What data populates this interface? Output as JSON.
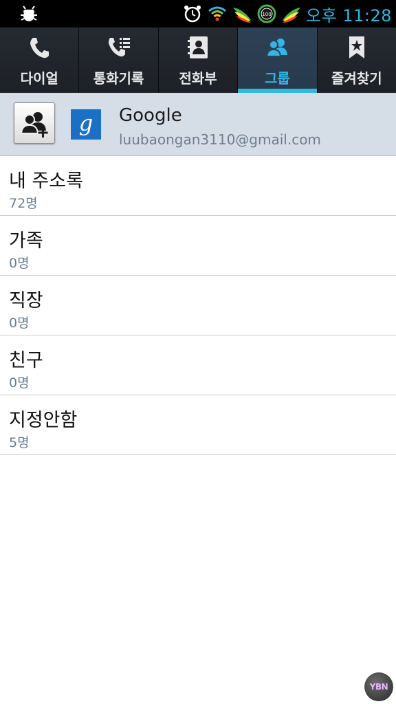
{
  "status_bar": {
    "time": "오후 11:28",
    "icons": [
      "debug-icon",
      "alarm-icon",
      "wifi-icon",
      "app-wing-icon",
      "battery-circle-icon",
      "app-wing-icon-2"
    ],
    "time_color": "#33b5e5"
  },
  "tabs": [
    {
      "label": "다이얼",
      "icon": "phone-icon",
      "active": false
    },
    {
      "label": "통화기록",
      "icon": "call-log-icon",
      "active": false
    },
    {
      "label": "전화부",
      "icon": "contacts-book-icon",
      "active": false
    },
    {
      "label": "그룹",
      "icon": "group-icon",
      "active": true
    },
    {
      "label": "즐겨찾기",
      "icon": "bookmark-star-icon",
      "active": false
    }
  ],
  "account": {
    "name": "Google",
    "email": "luubaongan3110@gmail.com",
    "logo_letter": "g",
    "add_button_icon": "add-group-icon"
  },
  "groups": [
    {
      "title": "내 주소록",
      "count": "72명"
    },
    {
      "title": "가족",
      "count": "0명"
    },
    {
      "title": "직장",
      "count": "0명"
    },
    {
      "title": "친구",
      "count": "0명"
    },
    {
      "title": "지정안함",
      "count": "5명"
    }
  ],
  "watermark": {
    "text": "YBN"
  },
  "colors": {
    "accent": "#33b5e5",
    "tab_bg": "#1c1f24",
    "account_bg": "#d5dde6"
  }
}
